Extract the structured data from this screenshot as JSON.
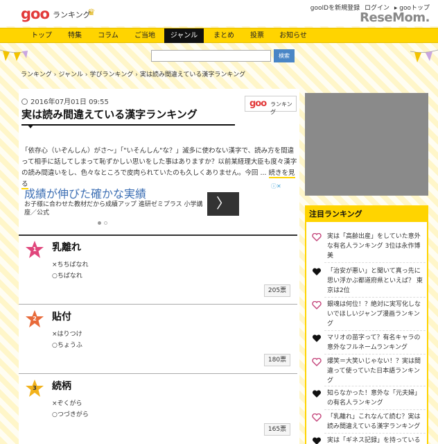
{
  "header": {
    "logo": "goo",
    "logo_sub": "ランキング",
    "util": [
      "gooIDを新規登録",
      "ログイン",
      "gooトップ"
    ],
    "brand": "ReseMom."
  },
  "nav": {
    "items": [
      "トップ",
      "特集",
      "コラム",
      "ご当地",
      "ジャンル",
      "まとめ",
      "投票",
      "お知らせ"
    ],
    "active_index": 4
  },
  "search": {
    "value": "",
    "button_label": "検索"
  },
  "breadcrumb": [
    "ランキング",
    "ジャンル",
    "学びランキング",
    "実は読み間違えている漢字ランキング"
  ],
  "article": {
    "datetime": "2016年07月01日 09:55",
    "badge_logo": "goo",
    "badge_text": "ランキング",
    "title": "実は読み間違えている漢字ランキング",
    "intro": "「依存心（いぞんしん）がさ～」「\"いそんしん\"な？」滅多に使わない漢字で、読み方を間違って相手に話してしまって恥ずかしい思いをした事はありますか？以前某経理大臣も度々漢字の読み間違いをし、色々なところで皮肉られていたのも久しくありません。今回 ...",
    "read_more": "続きを見る"
  },
  "ad": {
    "title": "成績が伸びた確かな実績",
    "text": "お子様に合わせた教材だから成績アップ 進研ゼミプラス 小学講座／公式",
    "arrow": "〉"
  },
  "rankings": [
    {
      "rank": "1",
      "word": "乳離れ",
      "wrong": "×ちちばなれ",
      "right": "○ちばなれ",
      "votes": "205票"
    },
    {
      "rank": "2",
      "word": "貼付",
      "wrong": "×はりつけ",
      "right": "○ちょうふ",
      "votes": "180票"
    },
    {
      "rank": "3",
      "word": "続柄",
      "wrong": "×ぞくがら",
      "right": "○つづきがら",
      "votes": "165票"
    }
  ],
  "sidebar": {
    "title": "注目ランキング",
    "items": [
      "実は「高齢出産」をしていた意外な有名人ランキング 3位は永作博美",
      "「治安が悪い」と聞いて真っ先に思い浮かぶ都道府県といえば？ 東京は2位",
      "銀魂は何位！？絶対に実写化しないでほしいジャンプ漫画ランキング",
      "マリオの苗字って？有名キャラの意外なフルネームランキング",
      "爆笑＝大笑いじゃない！？実は間違って使っていた日本語ランキング",
      "知らなかった！意外な「元夫婦」の有名人ランキング",
      "「乳離れ」これなんて読む？実は読み間違えている漢字ランキング",
      "実は「ギネス記録」を持っている"
    ]
  },
  "colors": {
    "accent": "#ffd400",
    "logo": "#e23a3a",
    "rank1": "#e0457b",
    "rank2": "#e86a3a",
    "rank3": "#f2b21b"
  }
}
